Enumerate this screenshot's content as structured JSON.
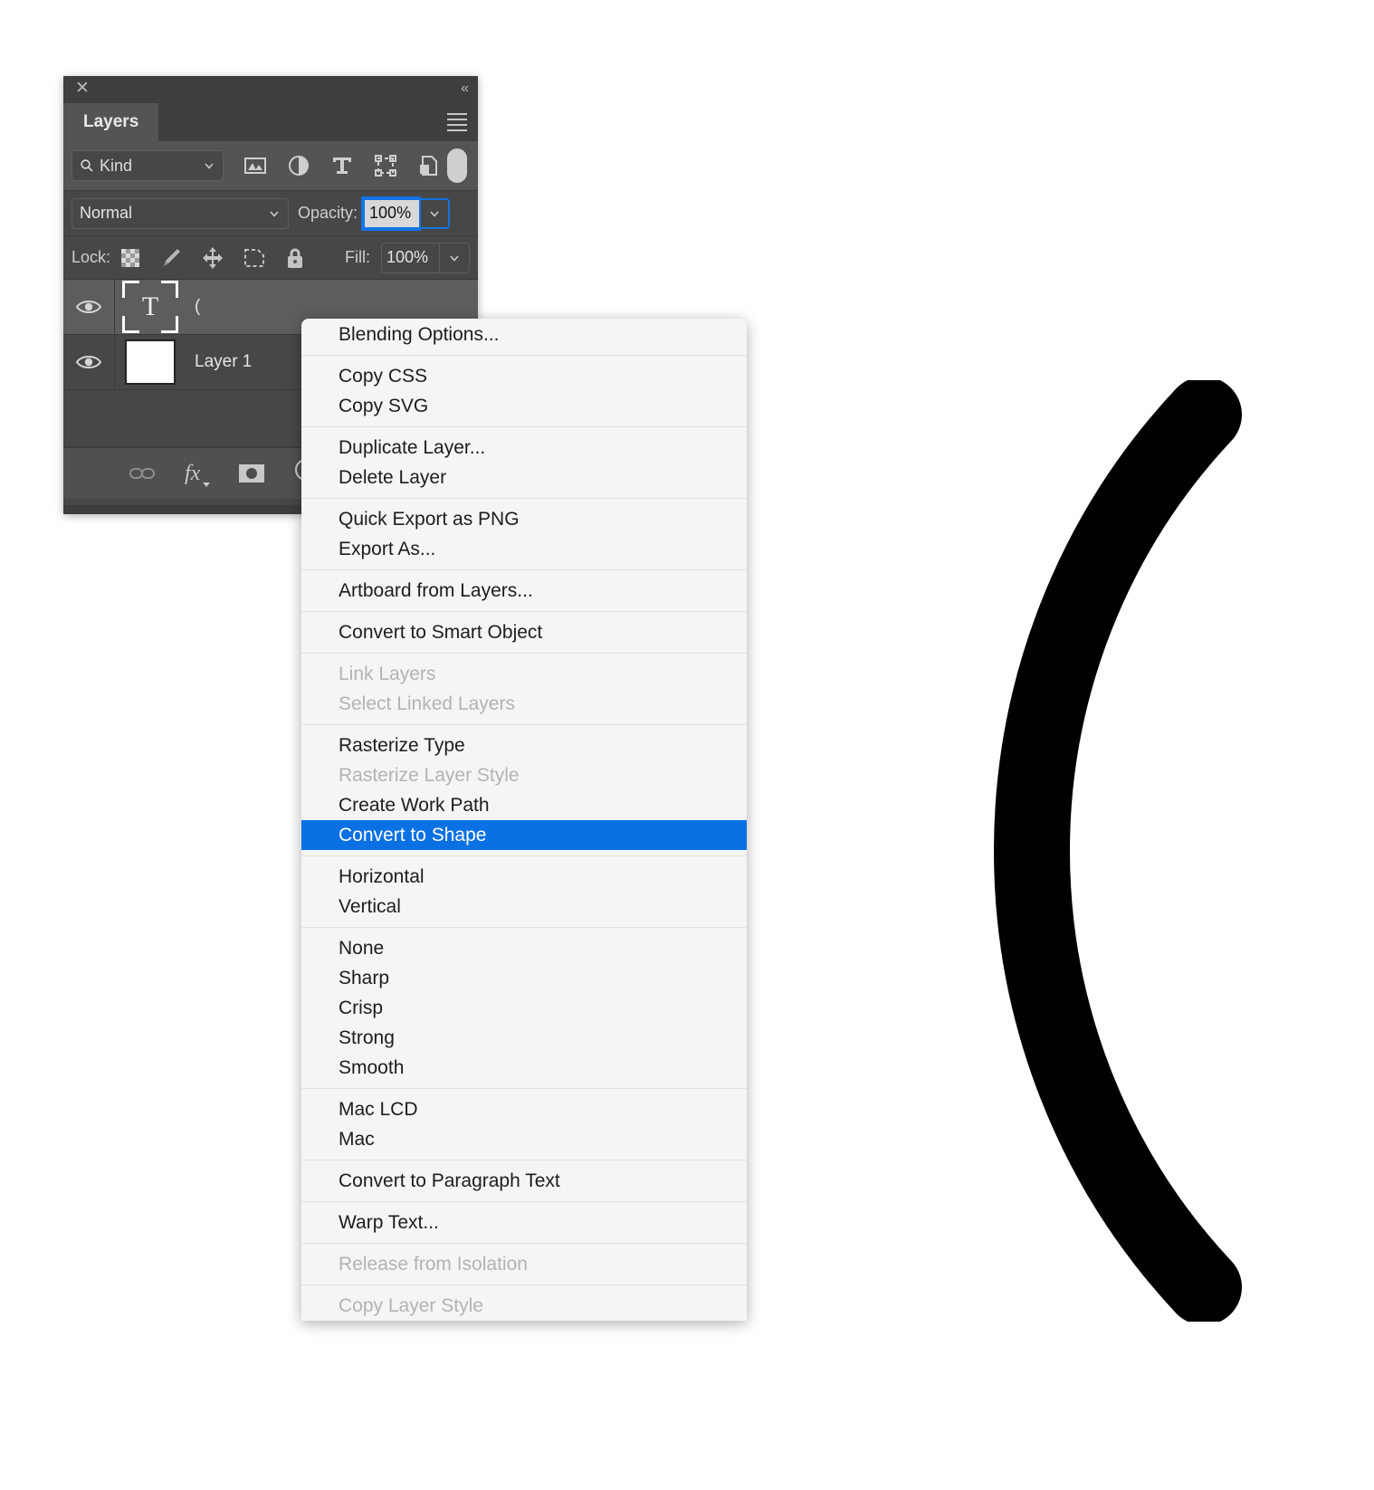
{
  "canvas": {
    "artwork_name": "left-parenthesis-glyph",
    "artwork_color": "#000000",
    "background_color": "#ffffff"
  },
  "panel": {
    "close_label": "✕",
    "collapse_label": "«",
    "tab_label": "Layers",
    "menu_label": "panel-menu",
    "filter": {
      "kind_label": "Kind",
      "icons": [
        "pixel-layers-icon",
        "adjustment-layers-icon",
        "type-layers-icon",
        "shape-layers-icon",
        "smart-object-icon"
      ],
      "toggle_label": "filter-toggle"
    },
    "blend": {
      "mode": "Normal",
      "opacity_label": "Opacity:",
      "opacity_value": "100%"
    },
    "lock": {
      "label": "Lock:",
      "icons": [
        "lock-transparent-pixels-icon",
        "lock-image-pixels-icon",
        "lock-position-icon",
        "lock-artboard-nesting-icon",
        "lock-all-icon"
      ],
      "fill_label": "Fill:",
      "fill_value": "100%"
    },
    "layers": [
      {
        "name": "(",
        "type": "text",
        "visible": true,
        "selected": true
      },
      {
        "name": "Layer 1",
        "type": "pixel",
        "visible": true,
        "selected": false
      }
    ],
    "footer_icons": [
      "link-layers-icon",
      "layer-style-fx-icon",
      "layer-mask-icon",
      "new-fill-adjustment-icon"
    ]
  },
  "context_menu": {
    "groups": [
      {
        "items": [
          {
            "label": "Blending Options...",
            "state": "enabled"
          }
        ]
      },
      {
        "items": [
          {
            "label": "Copy CSS",
            "state": "enabled"
          },
          {
            "label": "Copy SVG",
            "state": "enabled"
          }
        ]
      },
      {
        "items": [
          {
            "label": "Duplicate Layer...",
            "state": "enabled"
          },
          {
            "label": "Delete Layer",
            "state": "enabled"
          }
        ]
      },
      {
        "items": [
          {
            "label": "Quick Export as PNG",
            "state": "enabled"
          },
          {
            "label": "Export As...",
            "state": "enabled"
          }
        ]
      },
      {
        "items": [
          {
            "label": "Artboard from Layers...",
            "state": "enabled"
          }
        ]
      },
      {
        "items": [
          {
            "label": "Convert to Smart Object",
            "state": "enabled"
          }
        ]
      },
      {
        "items": [
          {
            "label": "Link Layers",
            "state": "disabled"
          },
          {
            "label": "Select Linked Layers",
            "state": "disabled"
          }
        ]
      },
      {
        "items": [
          {
            "label": "Rasterize Type",
            "state": "enabled"
          },
          {
            "label": "Rasterize Layer Style",
            "state": "disabled"
          },
          {
            "label": "Create Work Path",
            "state": "enabled"
          },
          {
            "label": "Convert to Shape",
            "state": "highlight"
          }
        ]
      },
      {
        "items": [
          {
            "label": "Horizontal",
            "state": "enabled"
          },
          {
            "label": "Vertical",
            "state": "enabled"
          }
        ]
      },
      {
        "items": [
          {
            "label": "None",
            "state": "enabled"
          },
          {
            "label": "Sharp",
            "state": "enabled"
          },
          {
            "label": "Crisp",
            "state": "enabled"
          },
          {
            "label": "Strong",
            "state": "enabled"
          },
          {
            "label": "Smooth",
            "state": "enabled"
          }
        ]
      },
      {
        "items": [
          {
            "label": "Mac LCD",
            "state": "enabled"
          },
          {
            "label": "Mac",
            "state": "enabled"
          }
        ]
      },
      {
        "items": [
          {
            "label": "Convert to Paragraph Text",
            "state": "enabled"
          }
        ]
      },
      {
        "items": [
          {
            "label": "Warp Text...",
            "state": "enabled"
          }
        ]
      },
      {
        "items": [
          {
            "label": "Release from Isolation",
            "state": "disabled"
          }
        ]
      },
      {
        "items": [
          {
            "label": "Copy Layer Style",
            "state": "disabled"
          }
        ]
      }
    ],
    "highlight_color": "#0a71e4"
  }
}
